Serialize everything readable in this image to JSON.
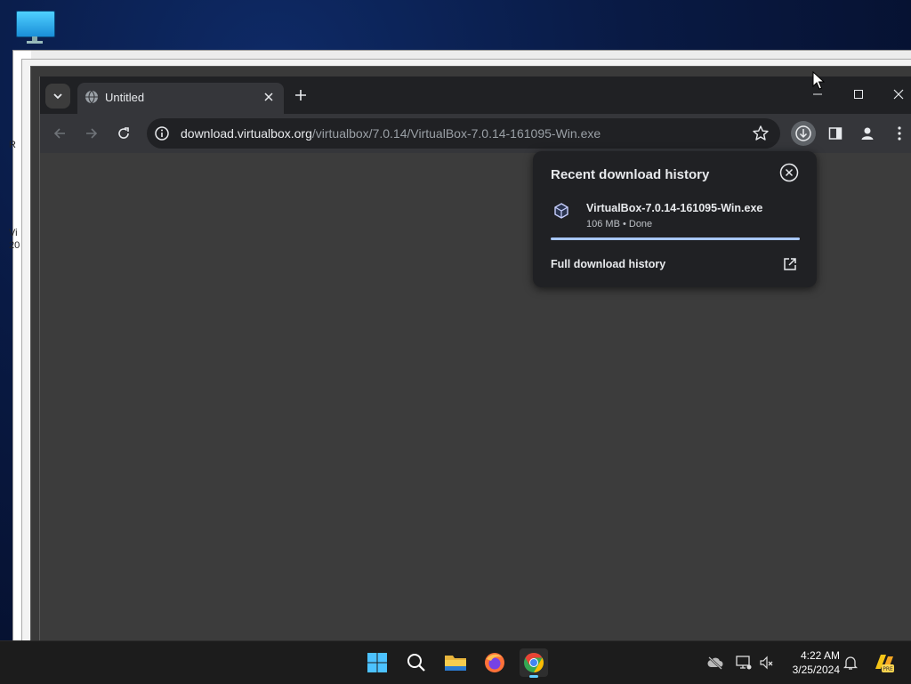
{
  "desktop": {
    "icon_name": "this-pc-icon"
  },
  "background_window": {
    "fragments": [
      "R",
      "Vi",
      "20"
    ]
  },
  "browser": {
    "tab": {
      "title": "Untitled"
    },
    "address": {
      "host": "download.virtualbox.org",
      "path": "/virtualbox/7.0.14/VirtualBox-7.0.14-161095-Win.exe"
    }
  },
  "download_bubble": {
    "heading": "Recent download history",
    "item": {
      "filename": "VirtualBox-7.0.14-161095-Win.exe",
      "status": "106 MB • Done",
      "progress": 1.0
    },
    "full_history_label": "Full download history"
  },
  "taskbar": {
    "time": "4:22 AM",
    "date": "3/25/2024",
    "apps": [
      "start",
      "search",
      "file-explorer",
      "firefox",
      "chrome"
    ]
  },
  "colors": {
    "accent": "#a8c7fa",
    "taskbar_indicator": "#60cdff",
    "browser_frame": "#202124"
  }
}
